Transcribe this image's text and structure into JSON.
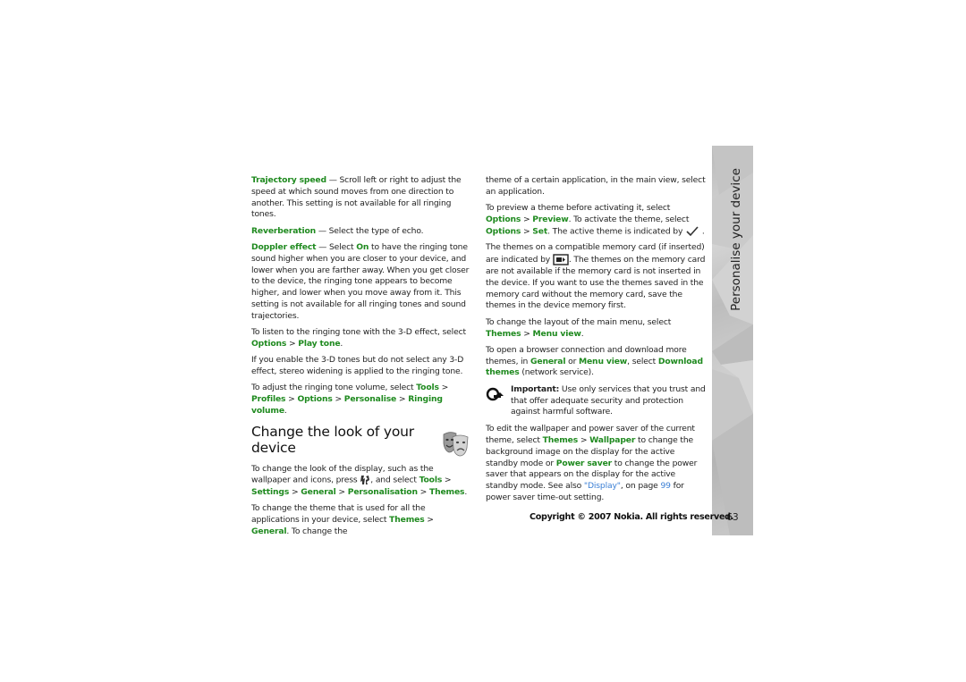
{
  "left_column": {
    "p1": {
      "term": "Trajectory speed",
      "text": " — Scroll left or right to adjust the speed at which sound moves from one direction to another. This setting is not available for all ringing tones."
    },
    "p2": {
      "term": "Reverberation",
      "text": " — Select the type of echo."
    },
    "p3": {
      "term": "Doppler effect",
      "t1": " — Select ",
      "on": "On",
      "t2": " to have the ringing tone sound higher when you are closer to your device, and lower when you are farther away. When you get closer to the device, the ringing tone appears to become higher, and lower when you move away from it. This setting is not available for all ringing tones and sound trajectories."
    },
    "p4": {
      "t1": "To listen to the ringing tone with the 3-D effect, select ",
      "opt": "Options",
      "sep": " > ",
      "play": "Play tone",
      "end": "."
    },
    "p5": {
      "text": "If you enable the 3-D tones but do not select any 3-D effect, stereo widening is applied to the ringing tone."
    },
    "p6": {
      "t1": "To adjust the ringing tone volume, select ",
      "tools": "Tools",
      "s1": " > ",
      "profiles": "Profiles",
      "s2": " > ",
      "options": "Options",
      "s3": " > ",
      "personalise": "Personalise",
      "s4": " > ",
      "ringing": "Ringing volume",
      "end": "."
    },
    "heading": "Change the look of your device",
    "p7": {
      "t1": "To change the look of the display, such as the wallpaper and icons, press ",
      "t2": ", and select ",
      "tools": "Tools",
      "s1": " > ",
      "settings": "Settings",
      "s2": " > ",
      "general": "General",
      "s3": " > ",
      "personalisation": "Personalisation",
      "s4": " > ",
      "themes": "Themes",
      "end": "."
    },
    "p8": {
      "t1": "To change the theme that is used for all the applications in your device, select ",
      "themes": "Themes",
      "s1": " > ",
      "general": "General",
      "t2": ". To change the"
    }
  },
  "right_column": {
    "p1": {
      "text": "theme of a certain application, in the main view, select an application."
    },
    "p2": {
      "t1": "To preview a theme before activating it, select ",
      "options": "Options",
      "s1": " > ",
      "preview": "Preview",
      "t2": ". To activate the theme, select ",
      "options2": "Options",
      "s2": " > ",
      "set": "Set",
      "t3": ". The active theme is indicated by ",
      "end": " ."
    },
    "p3": {
      "t1": "The themes on a compatible memory card (if inserted) are indicated by ",
      "t2": ". The themes on the memory card are not available if the memory card is not inserted in the device. If you want to use the themes saved in the memory card without the memory card, save the themes in the device memory first."
    },
    "p4": {
      "t1": "To change the layout of the main menu, select ",
      "themes": "Themes",
      "s1": " > ",
      "menu": "Menu view",
      "end": "."
    },
    "p5": {
      "t1": "To open a browser connection and download more themes, in ",
      "general": "General",
      "t2": " or ",
      "menu": "Menu view",
      "t3": ", select ",
      "download": "Download themes",
      "t4": " (network service)."
    },
    "important": {
      "label": "Important:",
      "text": " Use only services that you trust and that offer adequate security and protection against harmful software."
    },
    "p6": {
      "t1": "To edit the wallpaper and power saver of the current theme, select ",
      "themes": "Themes",
      "s1": " > ",
      "wallpaper": "Wallpaper",
      "t2": " to change the background image on the display for the active standby mode or ",
      "power": "Power saver",
      "t3": " to change the power saver that appears on the display for the active standby mode. See also ",
      "link": "\"Display\"",
      "t4": ", on page ",
      "page": "99",
      "t5": " for power saver time-out setting."
    }
  },
  "footer": {
    "copyright": "Copyright © 2007 Nokia. All rights reserved.",
    "page_number": "63"
  },
  "sidebar": {
    "section_title": "Personalise your device"
  },
  "colors": {
    "accent_green": "#1f8a1f",
    "link_blue": "#3a7fd5"
  }
}
